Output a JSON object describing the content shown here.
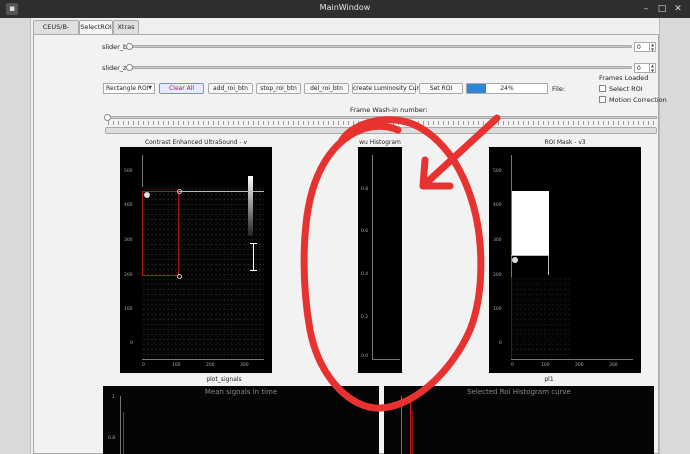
{
  "window": {
    "title": "MainWindow",
    "controls": [
      "–",
      "□",
      "✕"
    ]
  },
  "tabs": [
    {
      "label": "CEUS/B-mode",
      "active": false
    },
    {
      "label": "SelectROI",
      "active": true
    },
    {
      "label": "Xtras",
      "active": false
    }
  ],
  "sliders": {
    "b": {
      "label": "slider_b",
      "value": "0",
      "level": 0
    },
    "z": {
      "label": "slider_z",
      "value": "0",
      "level": 0
    }
  },
  "toolbar": {
    "roi_type": "Rectangle ROI",
    "clear_all": "Clear All",
    "add_roi": "add_roi_btn",
    "stop_roi": "stop_roi_btn",
    "del_roi": "del_roi_btn",
    "create_curve": "create Luminosity Curve",
    "set_roi": "Set ROI",
    "progress_text": "24%",
    "progress_value": 24,
    "file_label": "File:"
  },
  "options": {
    "frames_loaded": "Frames Loaded",
    "select_roi": "Select ROI",
    "motion_correction": "Motion Correction"
  },
  "frame_washin": {
    "label": "Frame Wash-in number:",
    "level": 0
  },
  "plots": {
    "ceus": {
      "title": "Contrast Enhanced UltraSound - v",
      "yticks": [
        "500",
        "400",
        "300",
        "200",
        "100",
        "0"
      ],
      "xticks": [
        "0",
        "100",
        "200",
        "300"
      ]
    },
    "histogram": {
      "title": "wu Histogram",
      "yticks": [
        "0.8",
        "0.6",
        "0.4",
        "0.2",
        "0.0"
      ]
    },
    "roi_mask": {
      "title": "ROI Mask - v3",
      "yticks": [
        "500",
        "400",
        "300",
        "200",
        "100",
        "0"
      ],
      "xticks": [
        "0",
        "100",
        "200",
        "300"
      ],
      "caption": "pl1"
    },
    "signals": {
      "header": "plot_signals",
      "title": "Mean signals in time",
      "yticks": [
        "1",
        "0.8"
      ]
    },
    "roi_curve": {
      "title": "Selected Roi Histogram curve"
    }
  },
  "annotation": {
    "color": "#e8322f"
  }
}
